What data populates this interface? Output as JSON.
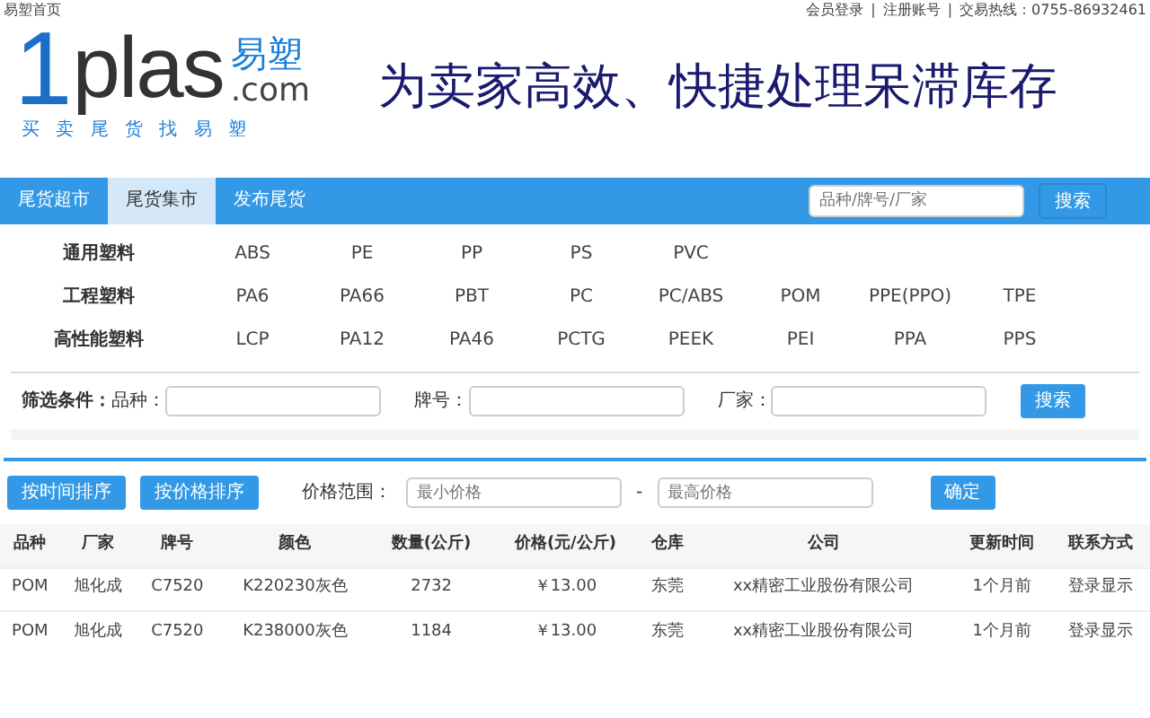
{
  "top_bar": {
    "home_link": "易塑首页",
    "links": [
      "会员登录",
      "注册账号"
    ],
    "separators": [
      "|",
      "|"
    ],
    "hotline": "交易热线：0755-86932461"
  },
  "logo": {
    "digit": "1",
    "word": "plas",
    "cn": "易塑",
    "domain": ".com",
    "tagline": "买 卖 尾 货 找 易 塑"
  },
  "slogan": "为卖家高效、快捷处理呆滞库存",
  "nav": {
    "tabs": [
      {
        "label": "尾货超市",
        "selected": false
      },
      {
        "label": "尾货集市",
        "selected": true
      },
      {
        "label": "发布尾货",
        "selected": false
      }
    ],
    "search": {
      "placeholder": "品种/牌号/厂家"
    },
    "search_button": "搜索"
  },
  "categories": [
    {
      "name": "通用塑料",
      "items": [
        "ABS",
        "PE",
        "PP",
        "PS",
        "PVC"
      ]
    },
    {
      "name": "工程塑料",
      "items": [
        "PA6",
        "PA66",
        "PBT",
        "PC",
        "PC/ABS",
        "POM",
        "PPE(PPO)",
        "TPE"
      ]
    },
    {
      "name": "高性能塑料",
      "items": [
        "LCP",
        "PA12",
        "PA46",
        "PCTG",
        "PEEK",
        "PEI",
        "PPA",
        "PPS"
      ]
    }
  ],
  "filter": {
    "title": "筛选条件：",
    "fields": [
      "品种：",
      "牌号：",
      "厂家："
    ],
    "button": "搜索"
  },
  "sort": {
    "buttons": [
      "按时间排序",
      "按价格排序"
    ],
    "range_label": "价格范围：",
    "min": {
      "placeholder": "最小价格"
    },
    "separator": "-",
    "max": {
      "placeholder": "最高价格"
    },
    "confirm": "确定"
  },
  "table": {
    "columns": [
      "品种",
      "厂家",
      "牌号",
      "颜色",
      "数量(公斤)",
      "价格(元/公斤)",
      "仓库",
      "公司",
      "更新时间",
      "联系方式"
    ],
    "rows": [
      [
        "POM",
        "旭化成",
        "C7520",
        "K220230灰色",
        "2732",
        "￥13.00",
        "东莞",
        "xx精密工业股份有限公司",
        "1个月前",
        "登录显示"
      ],
      [
        "POM",
        "旭化成",
        "C7520",
        "K238000灰色",
        "1184",
        "￥13.00",
        "东莞",
        "xx精密工业股份有限公司",
        "1个月前",
        "登录显示"
      ]
    ]
  }
}
